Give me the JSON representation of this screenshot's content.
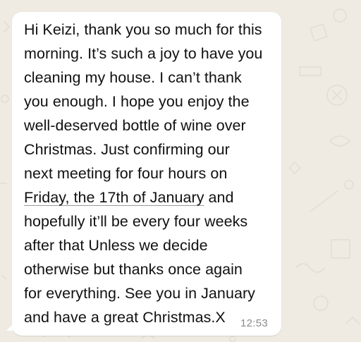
{
  "chat": {
    "wallpaper_color": "#efeae2",
    "bubble_color": "#ffffff",
    "message": {
      "lines_before_link": [
        "Hi Keizi, thank you so much for this",
        "morning. It’s such a joy to have you",
        "cleaning my house. I can’t thank",
        "you enough. I hope you enjoy the",
        "well-deserved bottle of wine over",
        "Christmas. Just confirming our",
        "next meeting for four hours on"
      ],
      "link_text": "Friday, the 17th of January",
      "link_line_suffix": " and",
      "lines_after_link": [
        "hopefully it’ll be every four weeks",
        "after that Unless we decide",
        "otherwise but thanks once again",
        "for everything. See you in January",
        "and have a great Christmas.X"
      ]
    },
    "timestamp": "12:53"
  }
}
